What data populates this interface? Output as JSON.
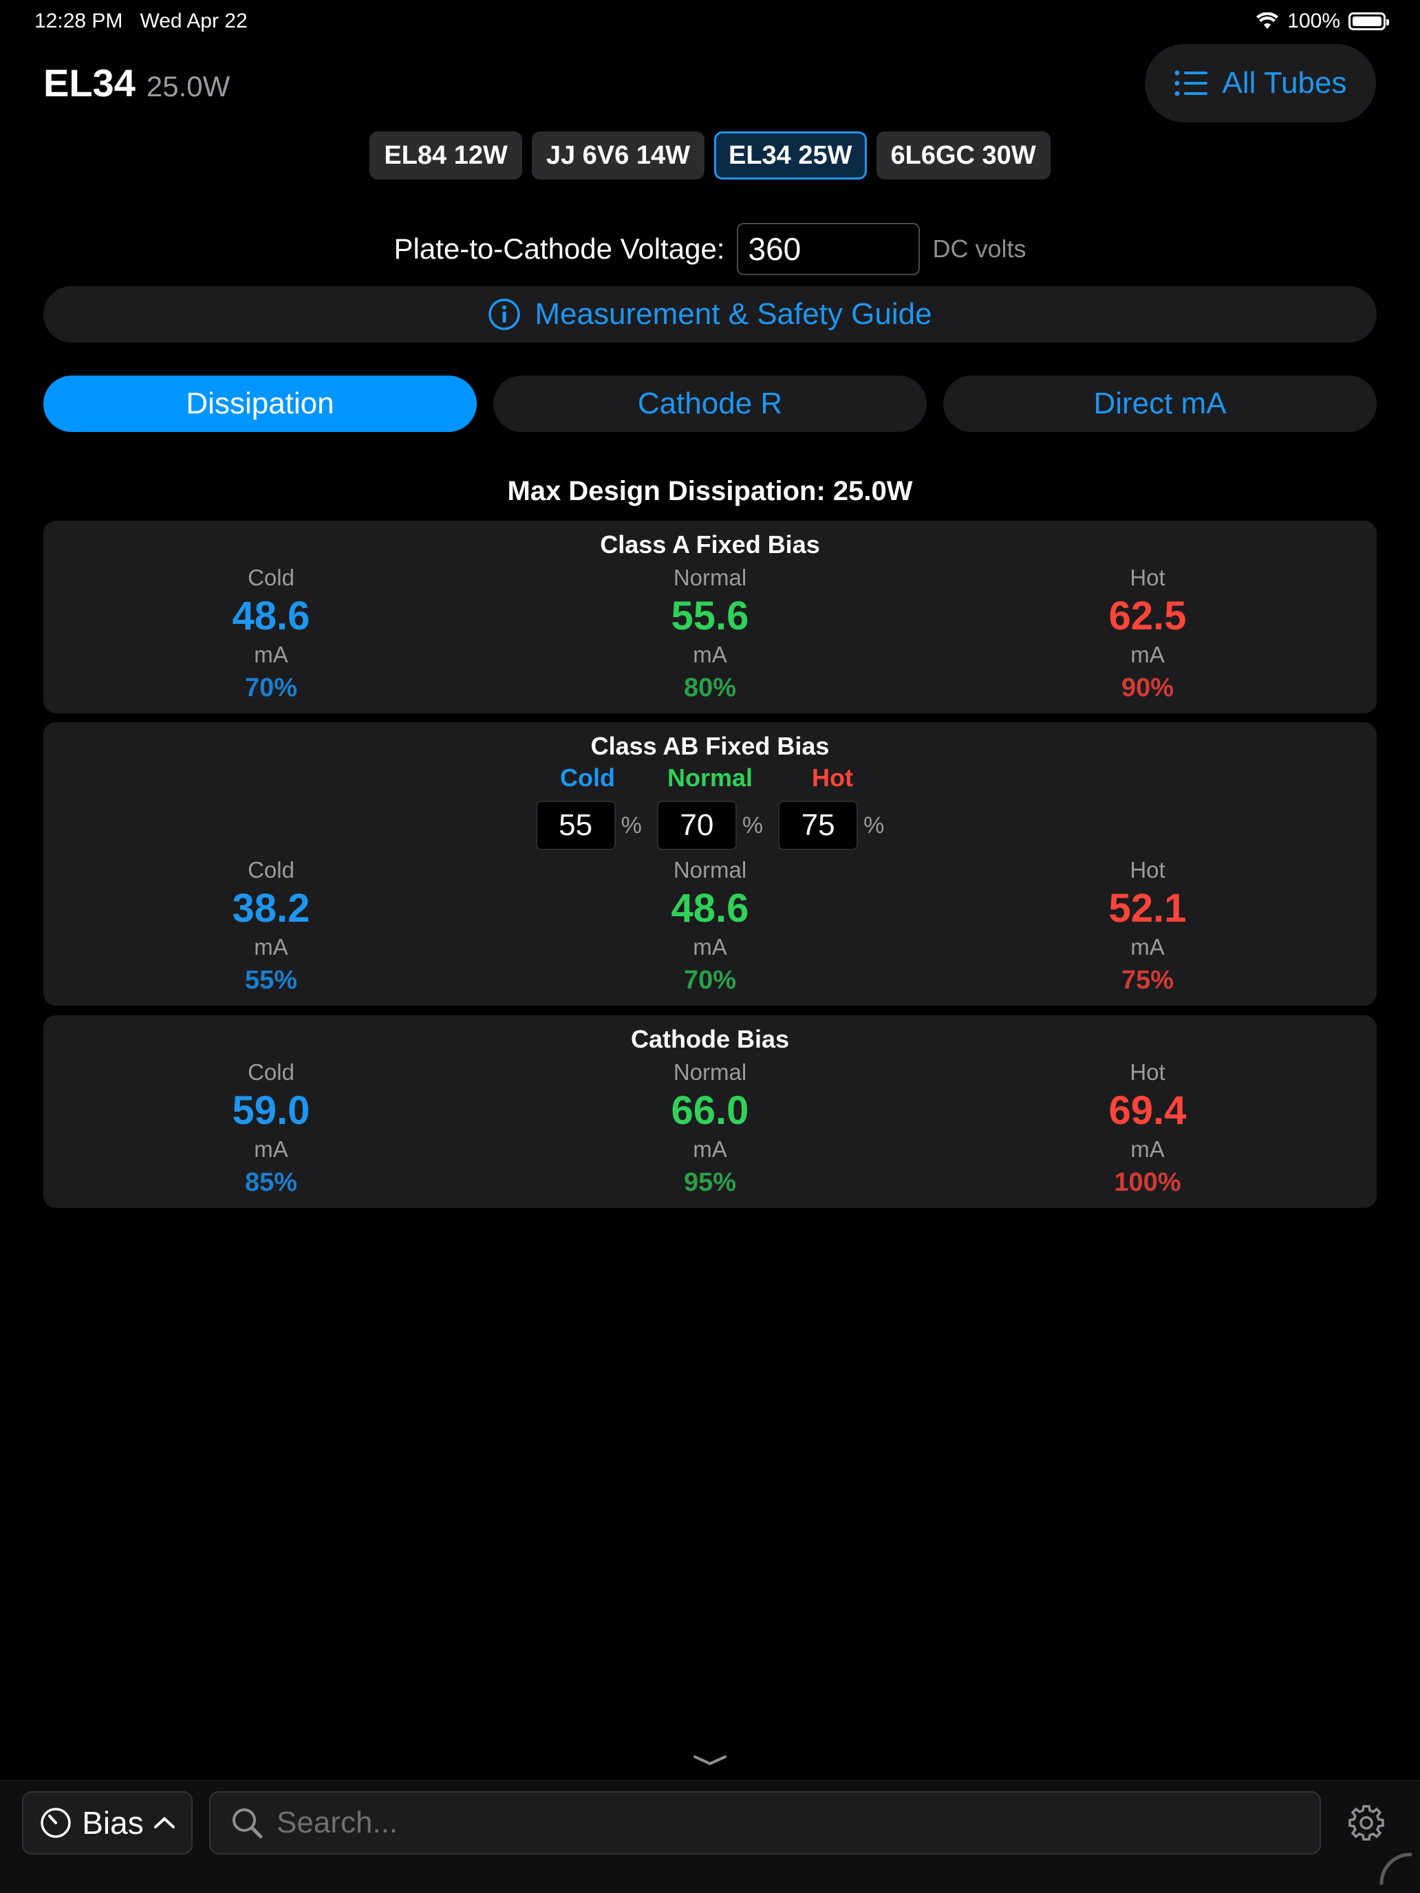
{
  "status_bar": {
    "time": "12:28 PM",
    "date": "Wed Apr 22",
    "battery": "100%"
  },
  "header": {
    "tube": "EL34",
    "watts": "25.0W",
    "all_tubes_label": "All Tubes"
  },
  "chips": [
    "EL84 12W",
    "JJ 6V6 14W",
    "EL34 25W",
    "6L6GC 30W"
  ],
  "selected_chip": "EL34 25W",
  "voltage": {
    "label": "Plate-to-Cathode Voltage:",
    "value": "360",
    "unit": "DC volts"
  },
  "guide_label": "Measurement & Safety Guide",
  "segments": [
    "Dissipation",
    "Cathode R",
    "Direct mA"
  ],
  "active_segment": "Dissipation",
  "max_dissipation": "Max Design Dissipation: 25.0W",
  "class_a": {
    "title": "Class A Fixed Bias",
    "cold": {
      "label": "Cold",
      "value": "48.6",
      "unit": "mA",
      "pct": "70%"
    },
    "normal": {
      "label": "Normal",
      "value": "55.6",
      "unit": "mA",
      "pct": "80%"
    },
    "hot": {
      "label": "Hot",
      "value": "62.5",
      "unit": "mA",
      "pct": "90%"
    }
  },
  "class_ab": {
    "title": "Class AB Fixed Bias",
    "headers": {
      "cold": "Cold",
      "normal": "Normal",
      "hot": "Hot"
    },
    "inputs": {
      "cold": "55",
      "normal": "70",
      "hot": "75",
      "suffix": "%"
    },
    "cold": {
      "label": "Cold",
      "value": "38.2",
      "unit": "mA",
      "pct": "55%"
    },
    "normal": {
      "label": "Normal",
      "value": "48.6",
      "unit": "mA",
      "pct": "70%"
    },
    "hot": {
      "label": "Hot",
      "value": "52.1",
      "unit": "mA",
      "pct": "75%"
    }
  },
  "cathode": {
    "title": "Cathode Bias",
    "cold": {
      "label": "Cold",
      "value": "59.0",
      "unit": "mA",
      "pct": "85%"
    },
    "normal": {
      "label": "Normal",
      "value": "66.0",
      "unit": "mA",
      "pct": "95%"
    },
    "hot": {
      "label": "Hot",
      "value": "69.4",
      "unit": "mA",
      "pct": "100%"
    }
  },
  "bottom": {
    "mode_label": "Bias",
    "search_placeholder": "Search..."
  },
  "icons": [
    "wifi-icon",
    "battery-icon",
    "list-icon",
    "info-icon",
    "gauge-icon",
    "chevron-up-icon",
    "chevron-down-icon",
    "search-icon",
    "gear-icon"
  ],
  "colors": {
    "accent": "#1e96f0",
    "cold": "#1e96f0",
    "normal": "#30d158",
    "hot": "#ff453a"
  }
}
